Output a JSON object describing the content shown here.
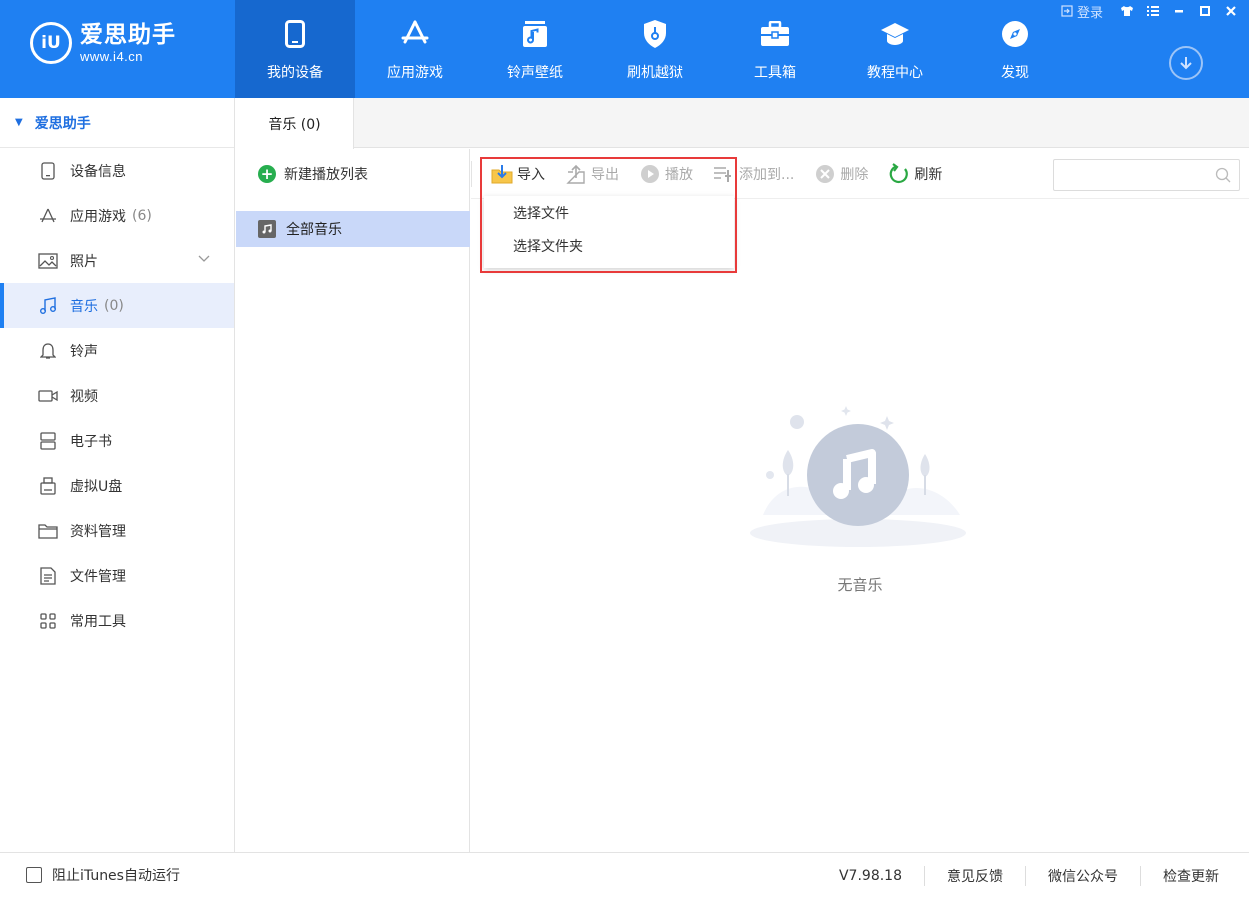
{
  "brand": {
    "badge": "iU",
    "name": "爱思助手",
    "url": "www.i4.cn"
  },
  "nav": {
    "items": [
      {
        "label": "我的设备",
        "icon": "phone-icon"
      },
      {
        "label": "应用游戏",
        "icon": "app-store-icon"
      },
      {
        "label": "铃声壁纸",
        "icon": "ringtone-icon"
      },
      {
        "label": "刷机越狱",
        "icon": "shield-icon"
      },
      {
        "label": "工具箱",
        "icon": "toolbox-icon"
      },
      {
        "label": "教程中心",
        "icon": "graduation-cap-icon"
      },
      {
        "label": "发现",
        "icon": "compass-icon"
      }
    ],
    "active": "我的设备"
  },
  "window": {
    "login_label": "登录"
  },
  "sidebar": {
    "header": "爱思助手",
    "items": [
      {
        "label": "设备信息",
        "count": "",
        "icon": "device-icon"
      },
      {
        "label": "应用游戏",
        "count": "(6)",
        "icon": "app-icon"
      },
      {
        "label": "照片",
        "count": "",
        "icon": "photo-icon"
      },
      {
        "label": "音乐",
        "count": "(0)",
        "icon": "music-icon"
      },
      {
        "label": "铃声",
        "count": "",
        "icon": "bell-icon"
      },
      {
        "label": "视频",
        "count": "",
        "icon": "video-icon"
      },
      {
        "label": "电子书",
        "count": "",
        "icon": "book-icon"
      },
      {
        "label": "虚拟U盘",
        "count": "",
        "icon": "usb-icon"
      },
      {
        "label": "资料管理",
        "count": "",
        "icon": "folder-icon"
      },
      {
        "label": "文件管理",
        "count": "",
        "icon": "file-icon"
      },
      {
        "label": "常用工具",
        "count": "",
        "icon": "grid-icon"
      }
    ],
    "active": "音乐"
  },
  "tabs": [
    {
      "label": "音乐 (0)"
    }
  ],
  "playlists": {
    "new_label": "新建播放列表",
    "items": [
      {
        "label": "全部音乐"
      }
    ]
  },
  "toolbar": {
    "import": "导入",
    "export": "导出",
    "play": "播放",
    "add_to": "添加到...",
    "delete": "删除",
    "refresh": "刷新",
    "search_placeholder": ""
  },
  "import_menu": {
    "items": [
      "选择文件",
      "选择文件夹"
    ]
  },
  "empty": {
    "text": "无音乐"
  },
  "footer": {
    "checkbox_label": "阻止iTunes自动运行",
    "checked": false,
    "version": "V7.98.18",
    "feedback": "意见反馈",
    "wechat": "微信公众号",
    "update": "检查更新"
  },
  "colors": {
    "brand": "#1f80f2",
    "nav_active": "#1668cf",
    "sidebar_active_bg": "#e8eefc",
    "highlight": "#e83a3a",
    "selected_row": "#c9d8f9"
  }
}
